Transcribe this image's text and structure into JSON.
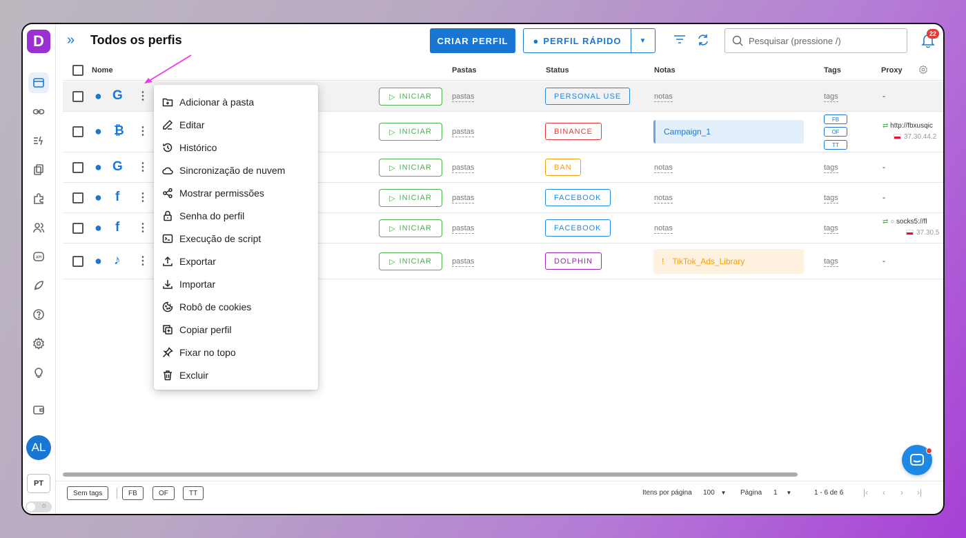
{
  "sidebar": {
    "logo_letter": "D",
    "avatar": "AL",
    "language": "PT",
    "icons": [
      "browser-icon",
      "link-icon",
      "automation-icon",
      "copy-icon",
      "extension-icon",
      "users-icon",
      "api-icon",
      "rocket-icon",
      "help-icon",
      "settings-icon",
      "lightbulb-icon",
      "wallet-icon"
    ]
  },
  "header": {
    "title": "Todos os perfis",
    "create_label": "CRIAR PERFIL",
    "quick_label": "PERFIL RÁPIDO",
    "search_placeholder": "Pesquisar (pressione /)",
    "notifications": "22"
  },
  "columns": {
    "name": "Nome",
    "folders": "Pastas",
    "status": "Status",
    "notes": "Notas",
    "tags": "Tags",
    "proxy": "Proxy"
  },
  "rows": [
    {
      "brand_icon": "G",
      "start": "INICIAR",
      "folders": "pastas",
      "status": "PERSONAL USE",
      "status_color": "#1e88e5",
      "notes": "notas",
      "tags": "tags",
      "proxy": "-"
    },
    {
      "brand_icon": "₿",
      "start": "INICIAR",
      "folders": "pastas",
      "status": "BINANCE",
      "status_color": "#e53935",
      "notes": "Campaign_1",
      "tags": [
        "FB",
        "OF",
        "TT"
      ],
      "proxy": "http://fbxusqic",
      "proxy_ip": "37.30.44.2"
    },
    {
      "brand_icon": "G",
      "start": "INICIAR",
      "folders": "pastas",
      "status": "BAN",
      "status_color": "#f59e0b",
      "notes": "notas",
      "tags": "tags",
      "proxy": "-"
    },
    {
      "brand_icon": "f",
      "start": "INICIAR",
      "folders": "pastas",
      "status": "FACEBOOK",
      "status_color": "#1e88e5",
      "notes": "notas",
      "tags": "tags",
      "proxy": "-"
    },
    {
      "brand_icon": "f",
      "start": "INICIAR",
      "folders": "pastas",
      "status": "FACEBOOK",
      "status_color": "#1e88e5",
      "notes": "notas",
      "tags": "tags",
      "proxy": "socks5://fl",
      "proxy_ip": "37.30.5"
    },
    {
      "brand_icon": "♪",
      "start": "INICIAR",
      "folders": "pastas",
      "status": "DOLPHIN",
      "status_color": "#9c27b0",
      "notes": "TikTok_Ads_Library",
      "tags": "tags",
      "proxy": "-"
    }
  ],
  "context_menu": [
    {
      "label": "Adicionar à pasta",
      "icon": "folder-add-icon"
    },
    {
      "label": "Editar",
      "icon": "edit-icon"
    },
    {
      "label": "Histórico",
      "icon": "history-icon"
    },
    {
      "label": "Sincronização de nuvem",
      "icon": "cloud-icon"
    },
    {
      "label": "Mostrar permissões",
      "icon": "share-icon"
    },
    {
      "label": "Senha do perfil",
      "icon": "lock-icon"
    },
    {
      "label": "Execução de script",
      "icon": "terminal-icon"
    },
    {
      "label": "Exportar",
      "icon": "upload-icon"
    },
    {
      "label": "Importar",
      "icon": "download-icon"
    },
    {
      "label": "Robô de cookies",
      "icon": "cookie-icon"
    },
    {
      "label": "Copiar perfil",
      "icon": "copy-icon"
    },
    {
      "label": "Fixar no topo",
      "icon": "pin-icon"
    },
    {
      "label": "Excluir",
      "icon": "trash-icon"
    }
  ],
  "footer": {
    "tags": [
      "Sem tags",
      "FB",
      "OF",
      "TT"
    ],
    "items_per_page_label": "Itens por página",
    "items_per_page": "100",
    "page_label": "Página",
    "page": "1",
    "range": "1 - 6 de 6"
  },
  "colors": {
    "accent": "#1976d2",
    "start": "#4caf50",
    "brand": "#9b2fd1"
  }
}
